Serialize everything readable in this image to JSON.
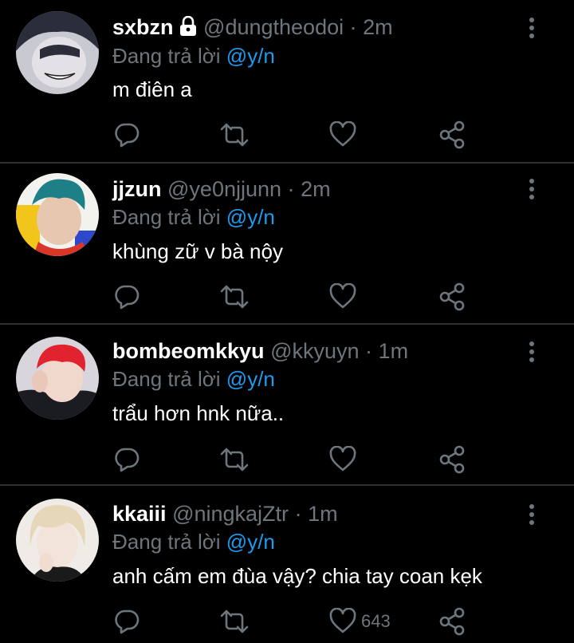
{
  "tweets": [
    {
      "display_name": "sxbzn",
      "locked": true,
      "handle": "@dungtheodoi",
      "separator": "·",
      "time": "2m",
      "reply_prefix": "Đang trả lời",
      "mention": "@y/n",
      "text": "m điên a",
      "like_count": "",
      "avatar_colors": {
        "bg": "#c9c9d2",
        "hair": "#2b2d3a",
        "skin": "#e4e1e6"
      }
    },
    {
      "display_name": "jjzun",
      "locked": false,
      "handle": "@ye0njjunn",
      "separator": "·",
      "time": "2m",
      "reply_prefix": "Đang trả lời",
      "mention": "@y/n",
      "text": "khùng zữ v bà nộy",
      "like_count": "",
      "avatar_colors": {
        "bg": "#f2f2ef",
        "hair": "#1f7f86",
        "skin": "#e8c7b0"
      }
    },
    {
      "display_name": "bombeomkkyu",
      "locked": false,
      "handle": "@kkyuyn",
      "separator": "·",
      "time": "1m",
      "reply_prefix": "Đang trả lời",
      "mention": "@y/n",
      "text": "trẩu hơn hnk nữa..",
      "like_count": "",
      "avatar_colors": {
        "bg": "#d8d5dd",
        "hair": "#e0232e",
        "skin": "#f1d8cc"
      }
    },
    {
      "display_name": "kkaiii",
      "locked": false,
      "handle": "@ningkajZtr",
      "separator": "·",
      "time": "1m",
      "reply_prefix": "Đang trả lời",
      "mention": "@y/n",
      "text": "anh cấm em đùa vậy? chia tay coan kẹk",
      "like_count": "643",
      "avatar_colors": {
        "bg": "#efece7",
        "hair": "#e6d7b8",
        "skin": "#f3e4da"
      }
    }
  ],
  "icons": {
    "reply": "reply-icon",
    "retweet": "retweet-icon",
    "like": "heart-icon",
    "share": "share-icon",
    "more": "more-vertical-icon",
    "lock": "lock-icon"
  },
  "colors": {
    "background": "#000000",
    "text": "#ffffff",
    "muted": "#6e767d",
    "mention": "#1d9bf0",
    "divider": "#2f3336"
  }
}
